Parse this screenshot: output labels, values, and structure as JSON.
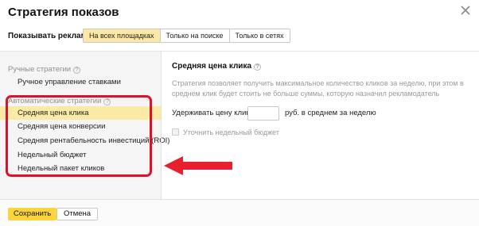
{
  "dialog": {
    "title": "Стратегия показов",
    "close_icon": "close-icon"
  },
  "show_ads": {
    "label": "Показывать рекламу:",
    "options": [
      "На всех площадках",
      "Только на поиске",
      "Только в сетях"
    ],
    "selected": "На всех площадках"
  },
  "sidebar": {
    "manual_group": "Ручные стратегии",
    "manual_items": [
      "Ручное управление ставками"
    ],
    "auto_group": "Автоматические стратегии",
    "auto_items": [
      "Средняя цена клика",
      "Средняя цена конверсии",
      "Средняя рентабельность инвестиций (ROI)",
      "Недельный бюджет",
      "Недельный пакет кликов"
    ],
    "selected": "Средняя цена клика",
    "help_icon": "?"
  },
  "strategy_panel": {
    "title": "Средняя цена клика",
    "description": "Стратегия позволяет получить максимальное количество кликов за неделю, при этом в среднем клик будет стоить не больше суммы, которую назначил рекламодатель",
    "hold_label": "Удерживать цену клика",
    "hold_value": "",
    "hold_suffix": "руб. в среднем за неделю",
    "weekly_budget_checkbox": "Уточнить недельный бюджет"
  },
  "footer": {
    "save": "Сохранить",
    "cancel": "Отмена"
  },
  "annotation": {
    "highlight_color": "#d9142a",
    "arrow_color": "#e8202e"
  }
}
